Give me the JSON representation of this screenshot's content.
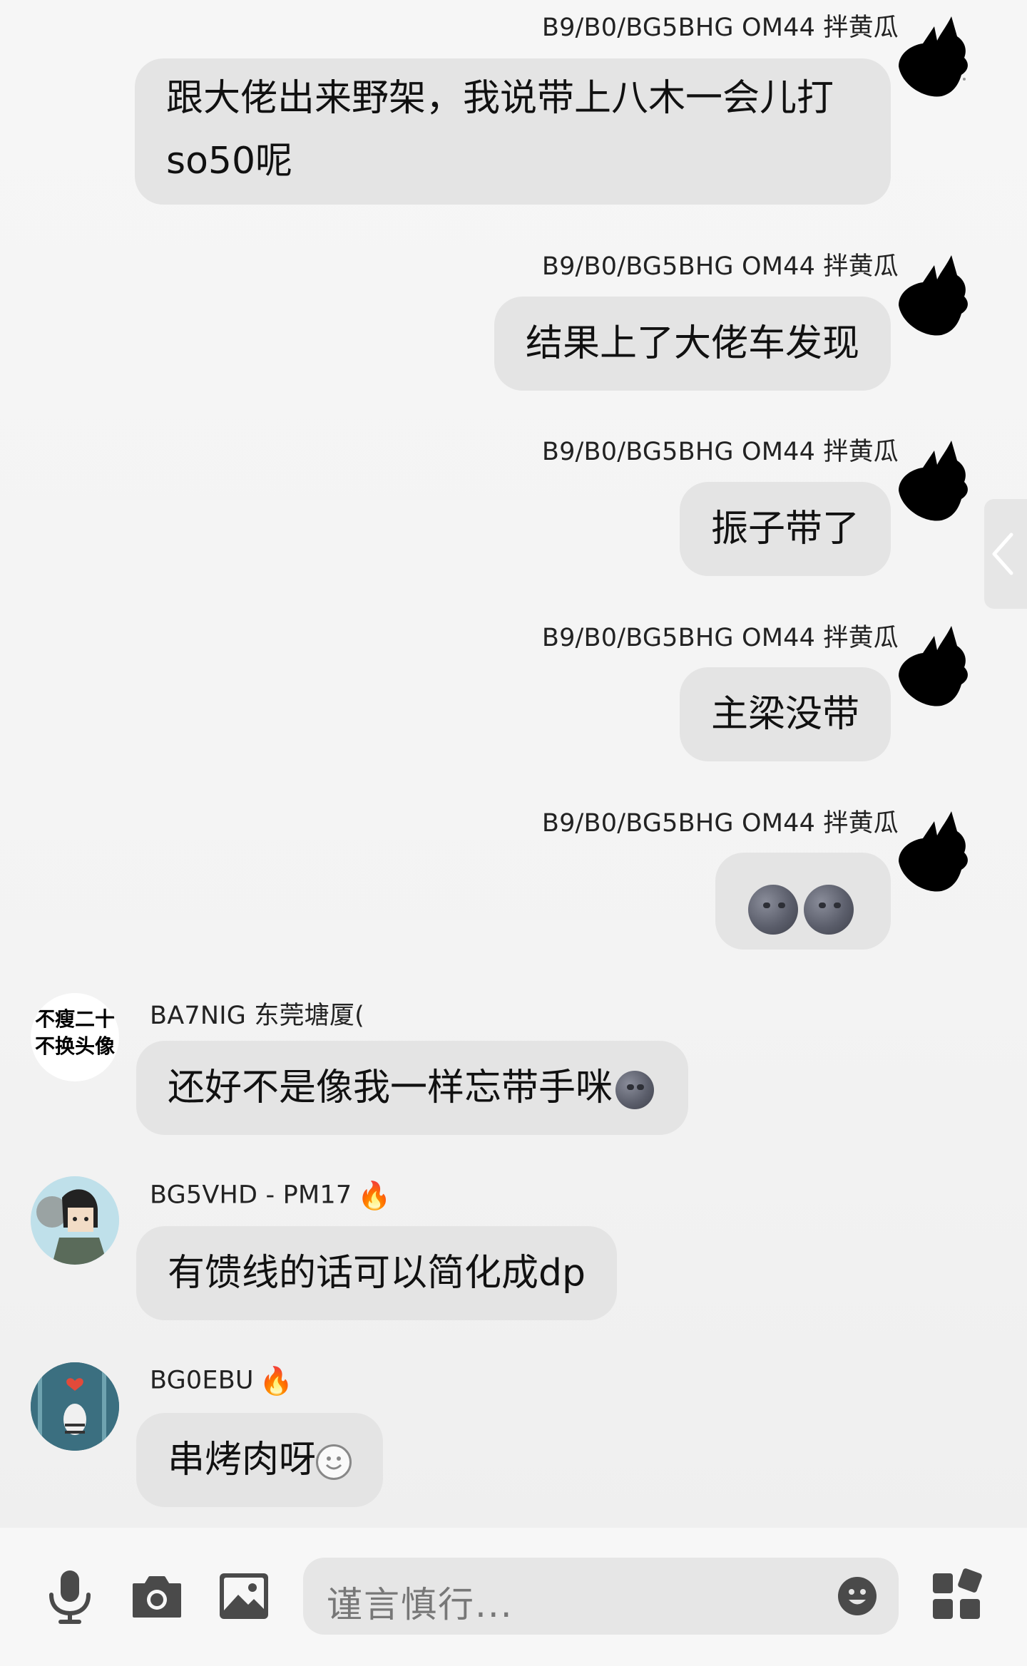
{
  "messages": [
    {
      "sender": "B9/B0/BG5BHG OM44  拌黄瓜",
      "line1": "跟大佬出来野架，我说带上八木一会儿打",
      "line2": "so50呢"
    },
    {
      "sender": "B9/B0/BG5BHG OM44  拌黄瓜",
      "text": "结果上了大佬车发现"
    },
    {
      "sender": "B9/B0/BG5BHG OM44  拌黄瓜",
      "text": "振子带了"
    },
    {
      "sender": "B9/B0/BG5BHG OM44  拌黄瓜",
      "text": "主梁没带"
    },
    {
      "sender": "B9/B0/BG5BHG OM44  拌黄瓜",
      "emoji": "new-moon-face-icon x2"
    },
    {
      "sender": "BA7NIG 东莞塘厦(",
      "text": "还好不是像我一样忘带手咪",
      "avatar_line1": "不瘦二十",
      "avatar_line2": "不换头像"
    },
    {
      "sender": "BG5VHD - PM17",
      "text": "有馈线的话可以简化成dp"
    },
    {
      "sender": "BG0EBU",
      "text": "串烤肉呀"
    }
  ],
  "input": {
    "placeholder": "谨言慎行..."
  },
  "colors": {
    "bubble": "#e4e4e4",
    "background": "#f4f4f4",
    "fire": "#f06a13"
  }
}
